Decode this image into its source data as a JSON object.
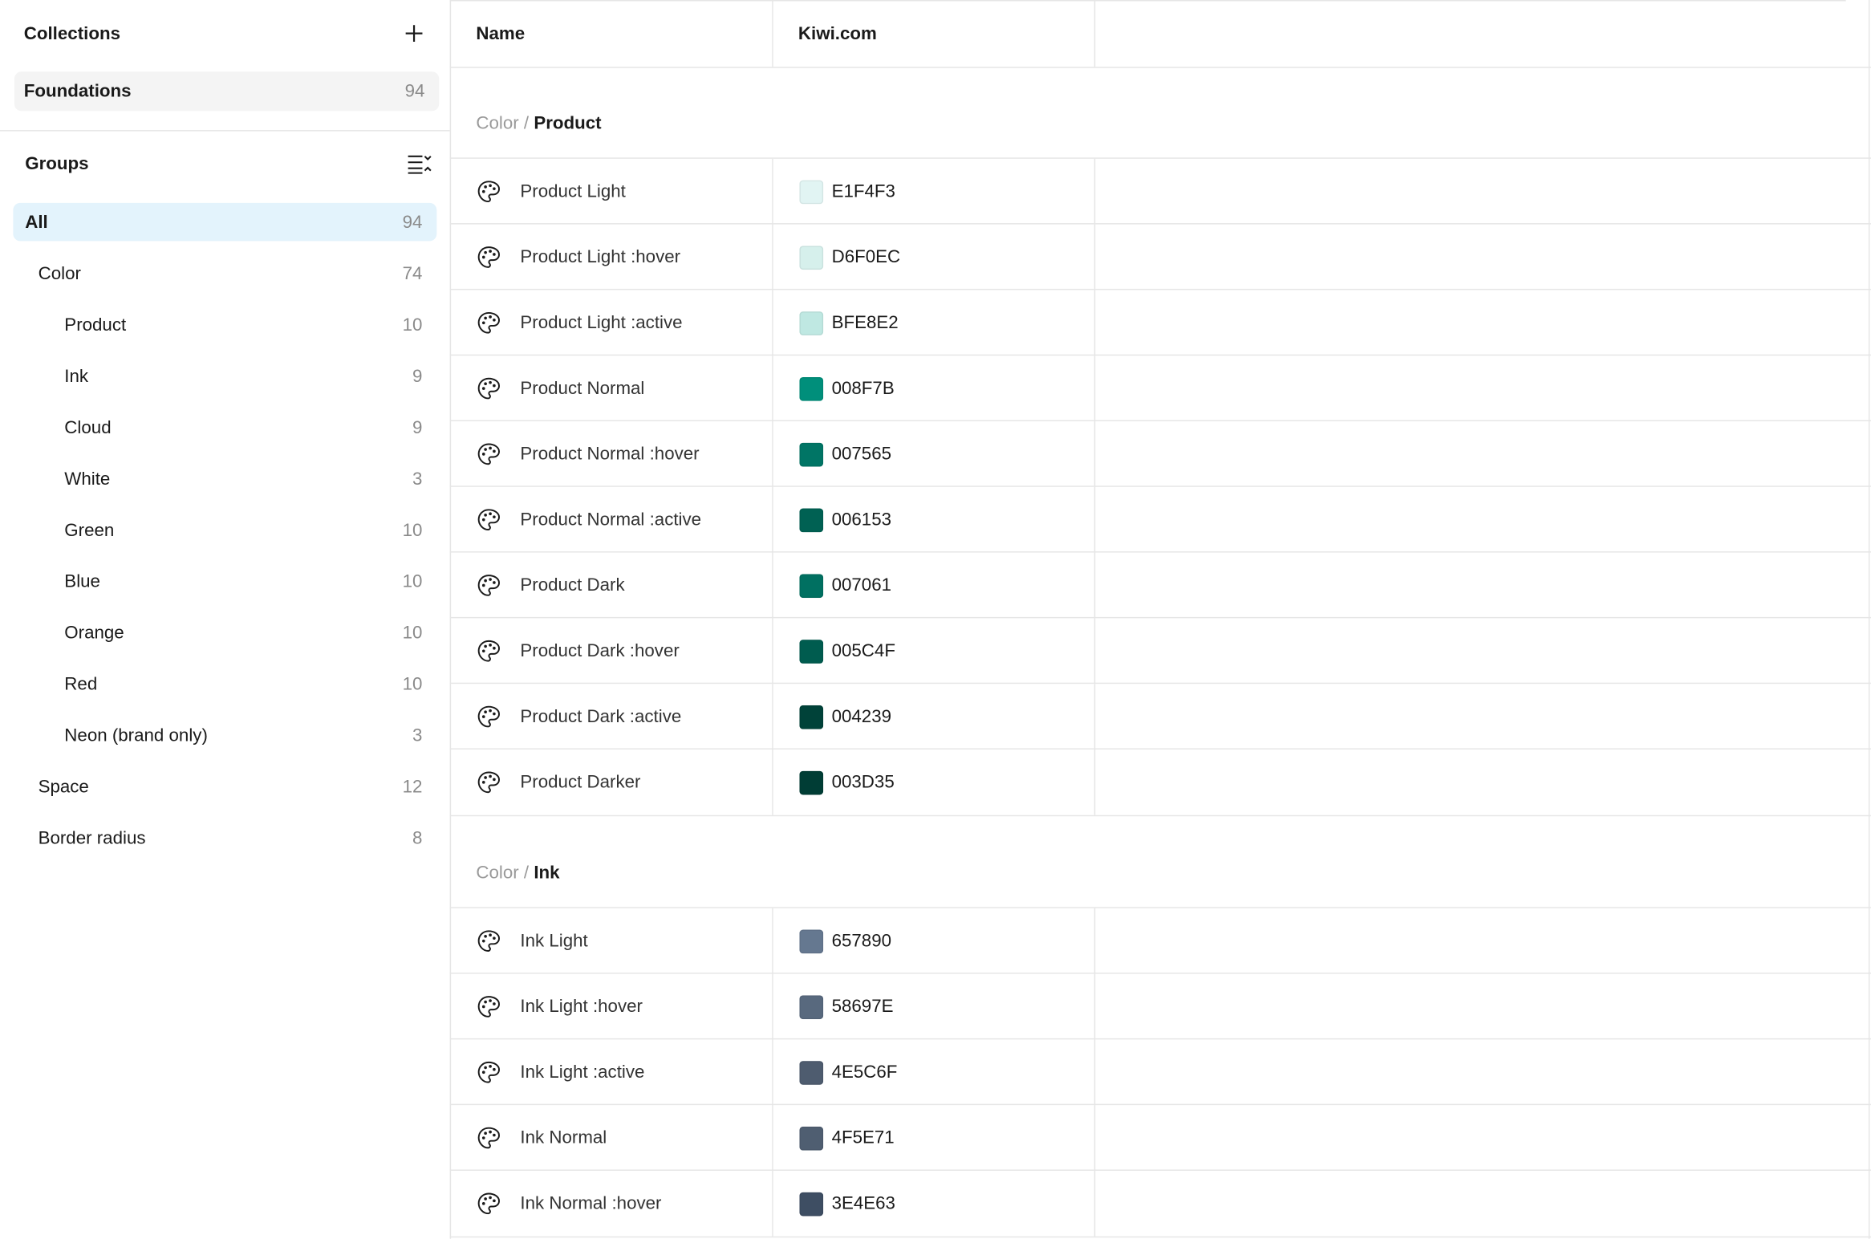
{
  "sidebar": {
    "collections_title": "Collections",
    "collection": {
      "label": "Foundations",
      "count": "94"
    },
    "groups_title": "Groups",
    "groups": [
      {
        "label": "All",
        "count": "94",
        "level": 0,
        "active": true
      },
      {
        "label": "Color",
        "count": "74",
        "level": 1
      },
      {
        "label": "Product",
        "count": "10",
        "level": 2
      },
      {
        "label": "Ink",
        "count": "9",
        "level": 2
      },
      {
        "label": "Cloud",
        "count": "9",
        "level": 2
      },
      {
        "label": "White",
        "count": "3",
        "level": 2
      },
      {
        "label": "Green",
        "count": "10",
        "level": 2
      },
      {
        "label": "Blue",
        "count": "10",
        "level": 2
      },
      {
        "label": "Orange",
        "count": "10",
        "level": 2
      },
      {
        "label": "Red",
        "count": "10",
        "level": 2
      },
      {
        "label": "Neon (brand only)",
        "count": "3",
        "level": 2
      },
      {
        "label": "Space",
        "count": "12",
        "level": 1
      },
      {
        "label": "Border radius",
        "count": "8",
        "level": 1
      }
    ]
  },
  "table": {
    "col_name": "Name",
    "col_mode": "Kiwi.com",
    "sections": [
      {
        "prefix": "Color",
        "separator": " / ",
        "name": "Product",
        "rows": [
          {
            "name": "Product Light",
            "value": "E1F4F3",
            "color": "#E1F4F3"
          },
          {
            "name": "Product Light :hover",
            "value": "D6F0EC",
            "color": "#D6F0EC"
          },
          {
            "name": "Product Light :active",
            "value": "BFE8E2",
            "color": "#BFE8E2"
          },
          {
            "name": "Product Normal",
            "value": "008F7B",
            "color": "#008F7B"
          },
          {
            "name": "Product Normal :hover",
            "value": "007565",
            "color": "#007565"
          },
          {
            "name": "Product Normal :active",
            "value": "006153",
            "color": "#006153"
          },
          {
            "name": "Product Dark",
            "value": "007061",
            "color": "#007061"
          },
          {
            "name": "Product Dark :hover",
            "value": "005C4F",
            "color": "#005C4F"
          },
          {
            "name": "Product Dark :active",
            "value": "004239",
            "color": "#004239"
          },
          {
            "name": "Product Darker",
            "value": "003D35",
            "color": "#003D35"
          }
        ]
      },
      {
        "prefix": "Color",
        "separator": " / ",
        "name": "Ink",
        "rows": [
          {
            "name": "Ink Light",
            "value": "657890",
            "color": "#657890"
          },
          {
            "name": "Ink Light :hover",
            "value": "58697E",
            "color": "#58697E"
          },
          {
            "name": "Ink Light :active",
            "value": "4E5C6F",
            "color": "#4E5C6F"
          },
          {
            "name": "Ink Normal",
            "value": "4F5E71",
            "color": "#4F5E71"
          },
          {
            "name": "Ink Normal :hover",
            "value": "3E4E63",
            "color": "#3E4E63"
          }
        ]
      }
    ]
  }
}
